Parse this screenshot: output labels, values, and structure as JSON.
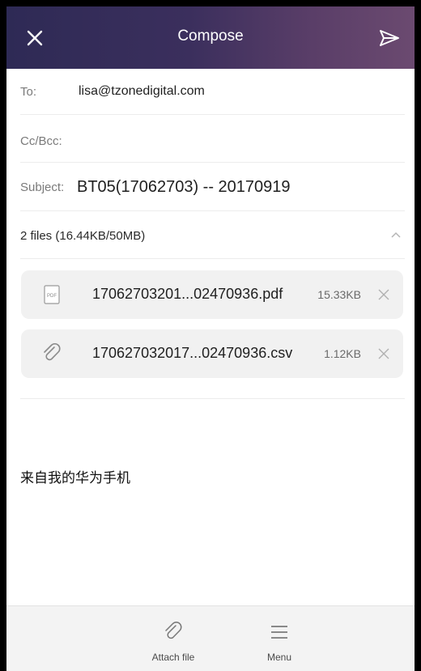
{
  "header": {
    "title": "Compose",
    "close_icon": "close-icon",
    "send_icon": "send-icon",
    "gradient_colors": [
      "#2e2a55",
      "#6b4a70"
    ]
  },
  "fields": {
    "to_label": "To:",
    "to_value": "lisa@tzonedigital.com",
    "cc_label": "Cc/Bcc:",
    "subject_label": "Subject:",
    "subject_value": "BT05(17062703) -- 20170919"
  },
  "attachments": {
    "summary": "2 files (16.44KB/50MB)",
    "items": [
      {
        "icon": "pdf-file-icon",
        "icon_text": "PDF",
        "name": "17062703201...02470936.pdf",
        "size": "15.33KB"
      },
      {
        "icon": "paperclip-icon",
        "name": "170627032017...02470936.csv",
        "size": "1.12KB"
      }
    ]
  },
  "body": {
    "text": "来自我的华为手机"
  },
  "bottom_bar": {
    "attach_label": "Attach file",
    "menu_label": "Menu"
  }
}
